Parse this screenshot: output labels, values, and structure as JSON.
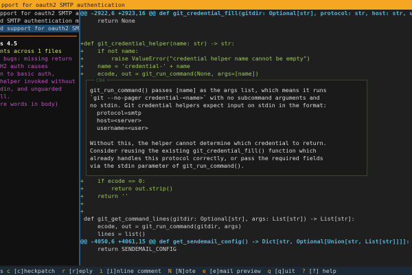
{
  "title": "pport for oauth2 SMTP authentication",
  "left": {
    "messages": [
      "pport for oauth2 SMTP a",
      "d SMTP authentication m",
      "d support for oauth2 SM"
    ],
    "selected_index": 2,
    "model": "s 4.5",
    "summary": "nts across 1 files",
    "notes": [
      " bugs: missing return",
      "H2 auth causes",
      "n to basic auth,",
      "helper invoked without",
      "din, and unguarded",
      "ll.",
      "re words in body)"
    ]
  },
  "diff_top": [
    {
      "t": "h",
      "text": "@@ -2922,6 +2923,16 @@ def git_credential_fill(gitdir: Optional[str], protocol: str, host: str, u"
    },
    {
      "t": "n",
      "text": "     return None"
    },
    {
      "t": "n",
      "text": ""
    },
    {
      "t": "n",
      "text": ""
    },
    {
      "t": "g",
      "text": "+def git_credential_helper(name: str) -> str:"
    },
    {
      "t": "g",
      "text": "+    if not name:"
    },
    {
      "t": "g",
      "text": "+        raise ValueError(\"credential helper name cannot be empty\")"
    },
    {
      "t": "g",
      "text": "+    name = 'credential-' + name"
    },
    {
      "t": "g",
      "text": "+    ecode, out = git_run_command(None, args=[name])"
    }
  ],
  "comment": {
    "label": "C04",
    "lines": [
      "git_run_command() passes [name] as the args list, which means it runs",
      "`git --no-pager credential-<name>` with no subcommand arguments and",
      "no stdin. Git credential helpers expect input on stdin in the format:",
      "  protocol=smtp",
      "  host=<server>",
      "  username=<user>",
      "",
      "Without this, the helper cannot determine which credential to return.",
      "Consider reusing the existing git_credential_fill() function which",
      "already handles this protocol correctly, or pass the required fields",
      "via the stdin parameter of git_run_command()."
    ]
  },
  "diff_bottom": [
    {
      "t": "g",
      "text": "+    if ecode == 0:"
    },
    {
      "t": "g",
      "text": "+        return out.strip()"
    },
    {
      "t": "g",
      "text": "+    return ''"
    },
    {
      "t": "g",
      "text": "+"
    },
    {
      "t": "g",
      "text": "+"
    },
    {
      "t": "n",
      "text": " def git_get_command_lines(gitdir: Optional[str], args: List[str]) -> List[str]:"
    },
    {
      "t": "n",
      "text": "     ecode, out = git_run_command(gitdir, args)"
    },
    {
      "t": "n",
      "text": "     lines = list()"
    },
    {
      "t": "h",
      "text": "@@ -4050,6 +4061,15 @@ def get_sendemail_config() -> Dict[str, Optional[Union[str, List[str]]]]:"
    },
    {
      "t": "n",
      "text": "     return SENDEMAIL_CONFIG"
    }
  ],
  "status": {
    "lead": "s ",
    "items": [
      {
        "key": "c",
        "label": "[c]heckpatch"
      },
      {
        "key": "r",
        "label": "[r]eply"
      },
      {
        "key": "i",
        "label": "[i]nline comment"
      },
      {
        "key": "N",
        "label": "[N]ote"
      },
      {
        "key": "e",
        "label": "[e]mail preview"
      },
      {
        "key": "q",
        "label": "[q]uit"
      },
      {
        "key": "?",
        "label": "[?] help"
      }
    ]
  },
  "colors": {
    "title_bar": "#f5a623",
    "hunk": "#56b6d8",
    "added": "#9cc95a",
    "note": "#c84cc8",
    "selection": "#1f4a6e"
  }
}
